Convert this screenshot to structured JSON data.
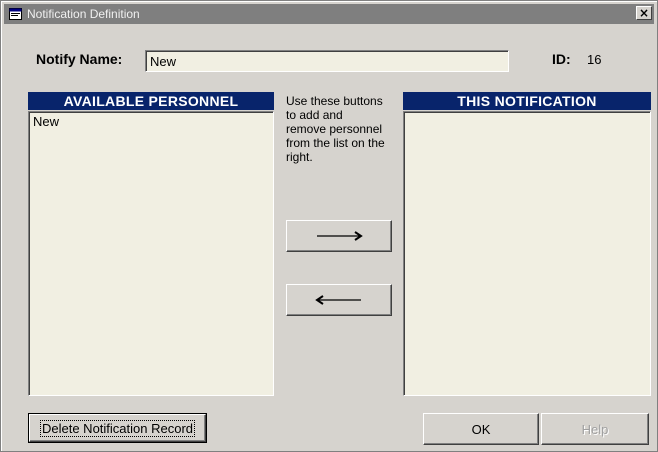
{
  "window": {
    "title": "Notification Definition",
    "close_label": "×"
  },
  "form": {
    "notify_name_label": "Notify Name:",
    "notify_name_value": "New",
    "id_label": "ID:",
    "id_value": "16"
  },
  "available": {
    "header": "AVAILABLE PERSONNEL",
    "items": [
      "New"
    ]
  },
  "this_notification": {
    "header": "THIS NOTIFICATION",
    "items": []
  },
  "instructions": "Use these buttons to add and remove personnel from the list on the right.",
  "buttons": {
    "add_icon": "right-arrow-icon",
    "remove_icon": "left-arrow-icon",
    "delete_label": "Delete Notification Record",
    "ok_label": "OK",
    "help_label": "Help"
  },
  "colors": {
    "header_bg": "#08246b",
    "dialog_bg": "#d6d3ce",
    "title_bar": "#7f7f7f"
  }
}
